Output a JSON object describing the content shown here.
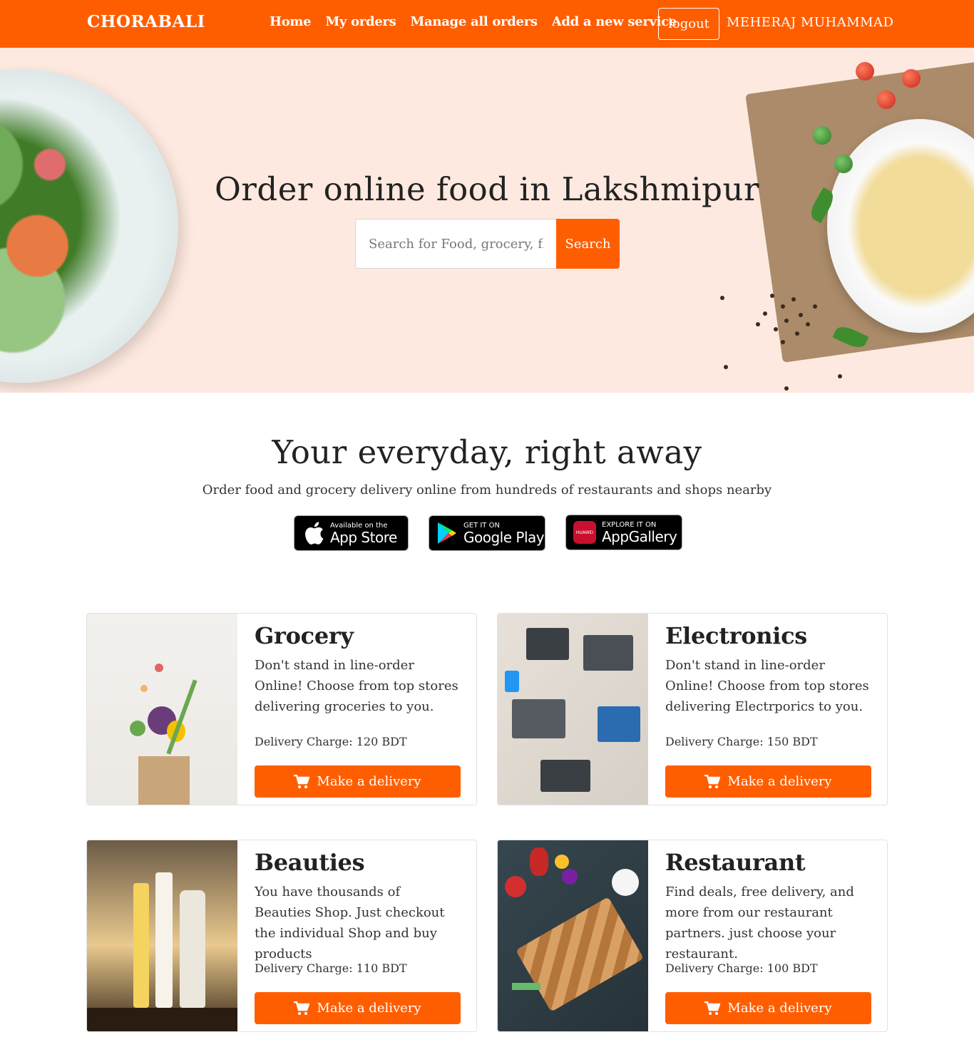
{
  "navbar": {
    "brand": "CHORABALI",
    "links": [
      "Home",
      "My orders",
      "Manage all orders",
      "Add a new service"
    ],
    "logout_label": "logout",
    "user_name": "MEHERAJ MUHAMMAD",
    "bg_color": "#ff5e00"
  },
  "hero": {
    "title": "Order online food in Lakshmipur",
    "search_placeholder": "Search for Food, grocery, flowers...",
    "search_button": "Search",
    "bg_color": "#fde9df"
  },
  "apps_section": {
    "title": "Your everyday, right away",
    "subtitle": "Order food and grocery delivery online from hundreds of restaurants and shops nearby",
    "badges": [
      {
        "small": "Available on the",
        "big": "App Store",
        "icon": "apple-icon"
      },
      {
        "small": "GET IT ON",
        "big": "Google Play",
        "icon": "google-play-icon"
      },
      {
        "small": "EXPLORE IT ON",
        "big": "AppGallery",
        "icon": "huawei-icon",
        "icon_text": "HUAWEI"
      }
    ]
  },
  "services": [
    {
      "title": "Grocery",
      "description": "Don't stand in line-order Online! Choose from top stores delivering groceries to you.",
      "charge": "Delivery Charge: 120 BDT",
      "button": "Make a delivery"
    },
    {
      "title": "Electronics",
      "description": "Don't stand in line-order Online! Choose from top stores delivering Electrporics to you.",
      "charge": "Delivery Charge: 150 BDT",
      "button": "Make a delivery"
    },
    {
      "title": "Beauties",
      "description": "You have thousands of Beauties Shop. Just checkout the individual Shop and buy products",
      "charge": "Delivery Charge: 110 BDT",
      "button": "Make a delivery"
    },
    {
      "title": "Restaurant",
      "description": "Find deals, free delivery, and more from our restaurant partners. just choose your restaurant.",
      "charge": "Delivery Charge: 100 BDT",
      "button": "Make a delivery"
    }
  ]
}
